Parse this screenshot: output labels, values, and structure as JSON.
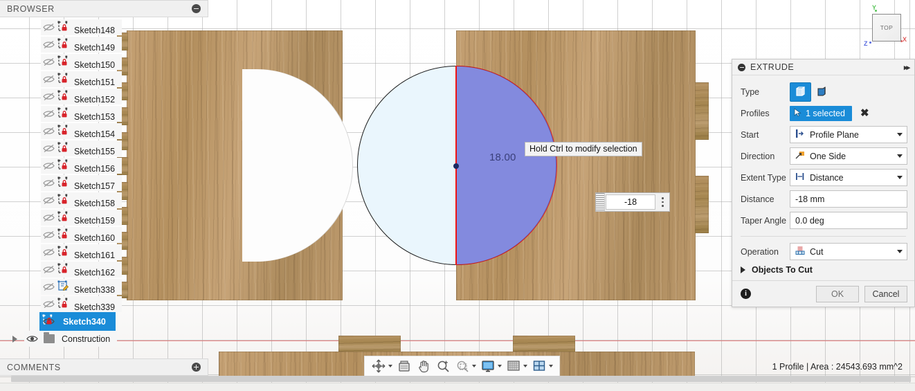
{
  "browser": {
    "title": "BROWSER",
    "collapse_icon": "minus-circle-icon",
    "items": [
      {
        "label": "Sketch148",
        "icon": "sketch-locked-icon",
        "visible": false,
        "selected": false
      },
      {
        "label": "Sketch149",
        "icon": "sketch-locked-icon",
        "visible": false,
        "selected": false
      },
      {
        "label": "Sketch150",
        "icon": "sketch-locked-icon",
        "visible": false,
        "selected": false
      },
      {
        "label": "Sketch151",
        "icon": "sketch-locked-icon",
        "visible": false,
        "selected": false
      },
      {
        "label": "Sketch152",
        "icon": "sketch-locked-icon",
        "visible": false,
        "selected": false
      },
      {
        "label": "Sketch153",
        "icon": "sketch-locked-icon",
        "visible": false,
        "selected": false
      },
      {
        "label": "Sketch154",
        "icon": "sketch-locked-icon",
        "visible": false,
        "selected": false
      },
      {
        "label": "Sketch155",
        "icon": "sketch-locked-icon",
        "visible": false,
        "selected": false
      },
      {
        "label": "Sketch156",
        "icon": "sketch-locked-icon",
        "visible": false,
        "selected": false
      },
      {
        "label": "Sketch157",
        "icon": "sketch-locked-icon",
        "visible": false,
        "selected": false
      },
      {
        "label": "Sketch158",
        "icon": "sketch-locked-icon",
        "visible": false,
        "selected": false
      },
      {
        "label": "Sketch159",
        "icon": "sketch-locked-icon",
        "visible": false,
        "selected": false
      },
      {
        "label": "Sketch160",
        "icon": "sketch-locked-icon",
        "visible": false,
        "selected": false
      },
      {
        "label": "Sketch161",
        "icon": "sketch-locked-icon",
        "visible": false,
        "selected": false
      },
      {
        "label": "Sketch162",
        "icon": "sketch-locked-icon",
        "visible": false,
        "selected": false
      },
      {
        "label": "Sketch338",
        "icon": "sketch-edit-icon",
        "visible": false,
        "selected": false
      },
      {
        "label": "Sketch339",
        "icon": "sketch-locked-icon",
        "visible": false,
        "selected": false
      },
      {
        "label": "Sketch340",
        "icon": "sketch-locked-icon",
        "visible": true,
        "selected": true
      }
    ],
    "construction": {
      "label": "Construction",
      "icon": "folder-icon",
      "visible": true
    }
  },
  "comments": {
    "title": "COMMENTS",
    "add_icon": "plus-circle-icon"
  },
  "extrude": {
    "title": "EXTRUDE",
    "collapse_icon": "minus-circle-icon",
    "expand_icon": "double-chevron-right-icon",
    "type": {
      "label": "Type",
      "options": [
        "solid-extrude-icon",
        "thin-extrude-icon"
      ],
      "selected_index": 0
    },
    "profiles": {
      "label": "Profiles",
      "value": "1 selected",
      "cursor_icon": "arrow-cursor-icon",
      "clear_icon": "x-icon"
    },
    "start": {
      "label": "Start",
      "value": "Profile Plane",
      "icon": "profile-plane-icon"
    },
    "direction": {
      "label": "Direction",
      "value": "One Side",
      "icon": "one-side-icon"
    },
    "extent_type": {
      "label": "Extent Type",
      "value": "Distance",
      "icon": "distance-icon"
    },
    "distance": {
      "label": "Distance",
      "value": "-18 mm"
    },
    "taper_angle": {
      "label": "Taper Angle",
      "value": "0.0 deg"
    },
    "operation": {
      "label": "Operation",
      "value": "Cut",
      "icon": "cut-operation-icon"
    },
    "objects_to_cut": {
      "label": "Objects To Cut",
      "icon": "triangle-right-icon"
    },
    "footer": {
      "info_icon": "info-icon",
      "info_glyph": "i",
      "ok": "OK",
      "cancel": "Cancel"
    },
    "accent_color": "#1a8cd8"
  },
  "canvas": {
    "tooltip": "Hold Ctrl to modify selection",
    "dimension_label": "18.00",
    "manipulator_value": "-18",
    "selected_profile_color": "#6d73d8",
    "highlight_edge_color": "#f01414",
    "sketch_edge_color": "#1a1a1a",
    "unselected_fill_color": "#eaf6fd",
    "wood_color": "#b89465"
  },
  "viewcube": {
    "face": "TOP",
    "axis_x": "X",
    "axis_y": "Y",
    "axis_z": "Z",
    "color_x": "#e05c5c",
    "color_y": "#5ac45a",
    "color_z": "#5a6ce0"
  },
  "navbar": {
    "items": [
      {
        "name": "orbit-icon",
        "has_caret": true
      },
      {
        "name": "look-at-icon",
        "has_caret": false
      },
      {
        "name": "pan-hand-icon",
        "has_caret": false
      },
      {
        "name": "zoom-magnifier-icon",
        "has_caret": false
      },
      {
        "name": "zoom-window-icon",
        "has_caret": true
      },
      {
        "name": "display-settings-icon",
        "has_caret": true
      },
      {
        "name": "grid-snaps-icon",
        "has_caret": true
      },
      {
        "name": "viewports-icon",
        "has_caret": true
      }
    ]
  },
  "statusbar": {
    "text": "1 Profile | Area : 24543.693 mm^2"
  }
}
